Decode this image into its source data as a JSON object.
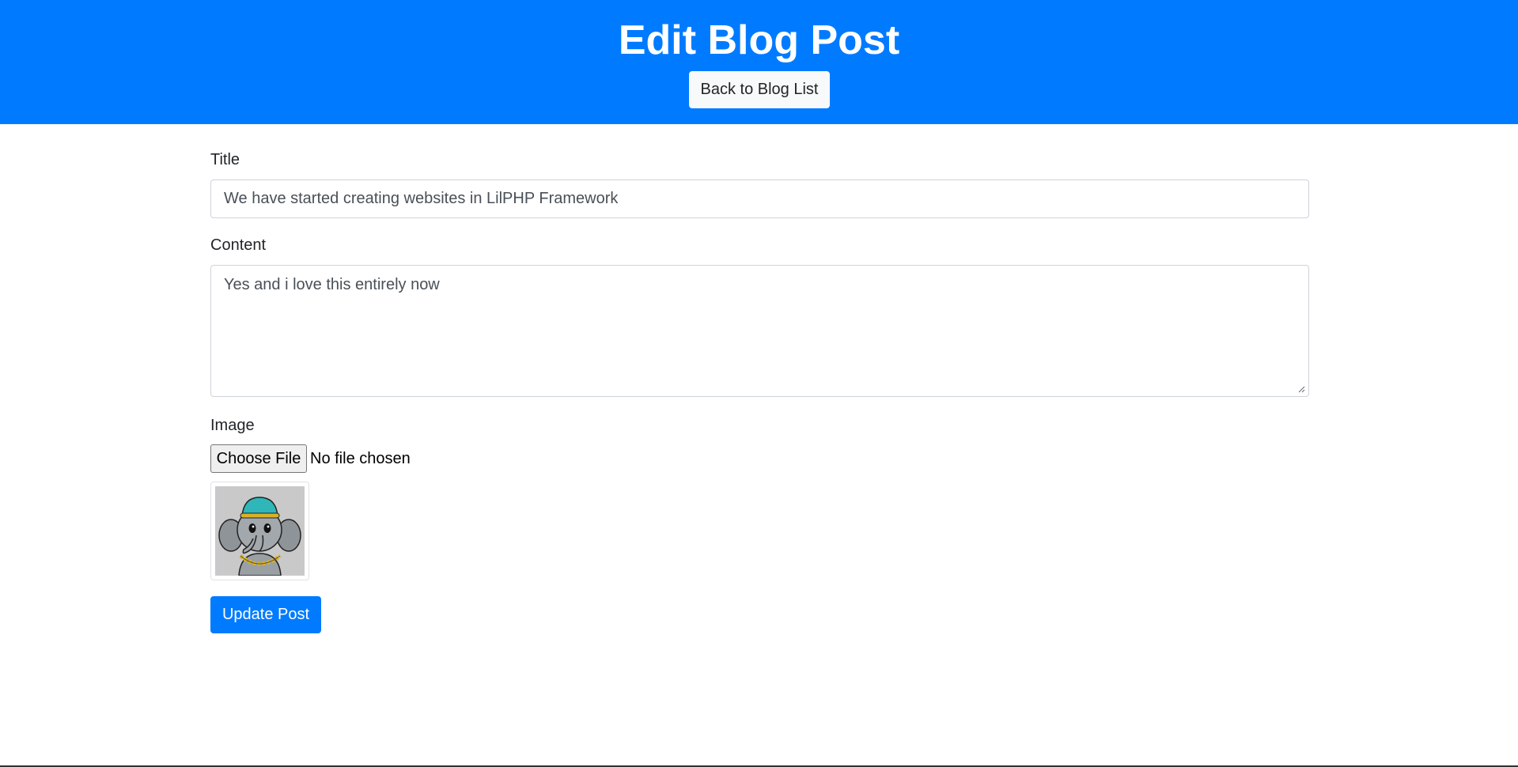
{
  "header": {
    "title": "Edit Blog Post",
    "back_button_label": "Back to Blog List",
    "background_color": "#007bff"
  },
  "form": {
    "title_label": "Title",
    "title_value": "We have started creating websites in LilPHP Framework",
    "content_label": "Content",
    "content_value": "Yes and i love this entirely now",
    "image_label": "Image",
    "file_button_label": "Choose File",
    "file_status": "No file chosen",
    "current_image_icon": "elephant-with-cap-and-chain",
    "submit_label": "Update Post",
    "submit_color": "#007bff"
  }
}
